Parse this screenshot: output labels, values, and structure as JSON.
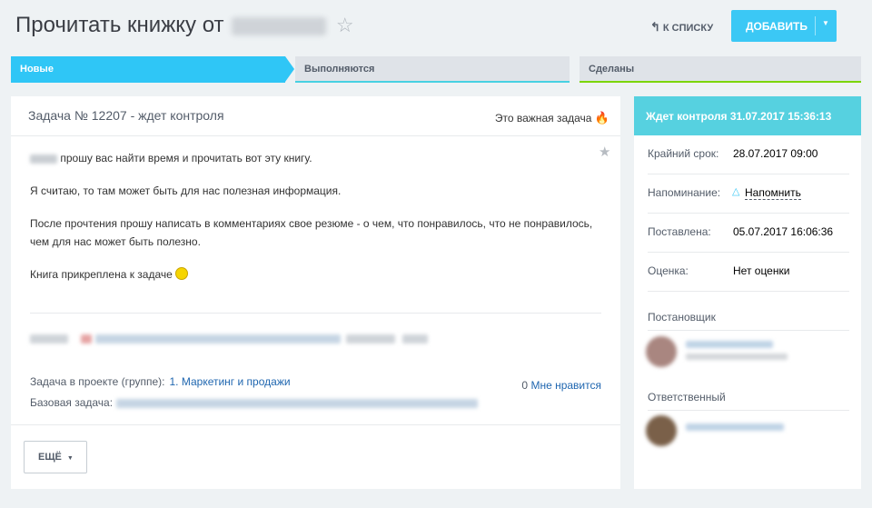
{
  "header": {
    "title": "Прочитать книжку от",
    "to_list_label": "К СПИСКУ",
    "add_label": "ДОБАВИТЬ"
  },
  "stages": [
    {
      "label": "Новые",
      "color": "#2fc6f6"
    },
    {
      "label": "Выполняются",
      "color": "#47d1e2"
    },
    {
      "label": "Сделаны",
      "color": "#7bd500"
    }
  ],
  "task": {
    "title": "Задача № 12207 - ждет контроля",
    "important_label": "Это важная задача",
    "paragraphs": [
      "прошу вас найти время и прочитать вот эту книгу.",
      "Я считаю, то там может быть для нас полезная информация.",
      "После прочтения прошу написать в комментариях свое резюме - о чем, что понравилось, что не понравилось, чем для нас может быть полезно.",
      "Книга прикреплена к задаче"
    ],
    "project_label": "Задача в проекте (группе):",
    "project_value": "1. Маркетинг и продажи",
    "base_label": "Базовая задача:",
    "like_count": "0",
    "like_label": "Мне нравится",
    "more_label": "ЕЩЁ"
  },
  "sidebar": {
    "status": "Ждет контроля 31.07.2017 15:36:13",
    "deadline_label": "Крайний срок:",
    "deadline_value": "28.07.2017 09:00",
    "reminder_label": "Напоминание:",
    "reminder_value": "Напомнить",
    "created_label": "Поставлена:",
    "created_value": "05.07.2017 16:06:36",
    "rating_label": "Оценка:",
    "rating_value": "Нет оценки",
    "creator_title": "Постановщик",
    "responsible_title": "Ответственный"
  }
}
